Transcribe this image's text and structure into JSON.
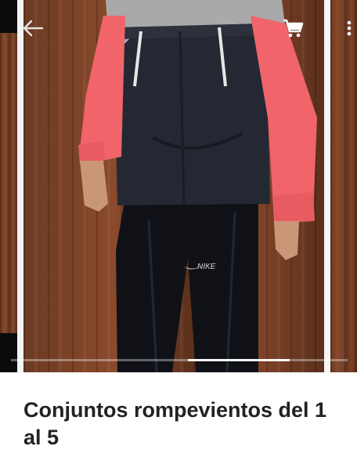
{
  "toolbar": {
    "back_icon": "arrow-left-icon",
    "cart_icon": "shopping-cart-icon",
    "more_icon": "more-vertical-icon"
  },
  "product": {
    "title": "Conjuntos rompevientos del 1 al 5",
    "image_logo_text": "NIKE"
  },
  "gallery": {
    "position_fraction": 0.6
  },
  "colors": {
    "jacket_body": "#2b2f3a",
    "sleeve": "#f0646a",
    "hood": "#a9a9a9",
    "wood": "#6b3a22"
  }
}
